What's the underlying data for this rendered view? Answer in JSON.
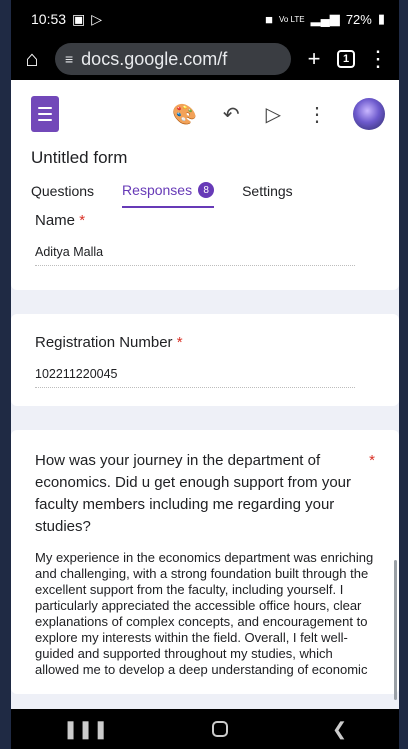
{
  "status": {
    "time": "10:53",
    "signal_text": "Vo LTE",
    "battery": "72%"
  },
  "browser": {
    "url": "docs.google.com/f",
    "tab_count": "1"
  },
  "form": {
    "title": "Untitled form",
    "tabs": [
      {
        "label": "Questions"
      },
      {
        "label": "Responses",
        "badge": "8"
      },
      {
        "label": "Settings"
      }
    ]
  },
  "responses": [
    {
      "label": "Name",
      "required": "*",
      "value": "Aditya Malla"
    },
    {
      "label": "Registration Number",
      "required": "*",
      "value": "102211220045"
    }
  ],
  "long_question": {
    "label": "How was your journey in the department of economics. Did u get enough support from your faculty members including me regarding your studies?",
    "required": "*",
    "answer": "My experience in the economics department was enriching and challenging, with a strong foundation built through the excellent support from the faculty, including yourself. I particularly appreciated the accessible office hours, clear explanations of complex concepts, and encouragement to explore my interests within the field. Overall, I felt well-guided and supported throughout my studies, which allowed me to develop a deep understanding of economic"
  },
  "colors": {
    "accent": "#673ab7",
    "required": "#d93025",
    "background": "#eef0f7"
  }
}
